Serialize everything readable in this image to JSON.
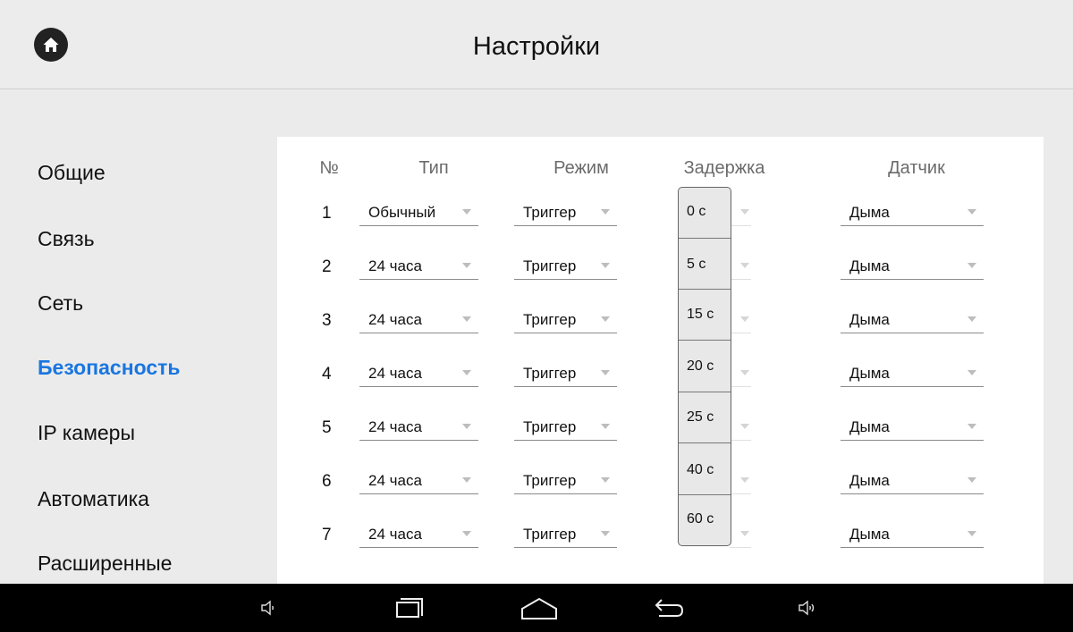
{
  "header": {
    "title": "Настройки"
  },
  "sidebar": {
    "items": [
      {
        "label": "Общие"
      },
      {
        "label": "Связь"
      },
      {
        "label": "Сеть"
      },
      {
        "label": "Безопасность",
        "active": true
      },
      {
        "label": "IP камеры"
      },
      {
        "label": "Автоматика"
      },
      {
        "label": "Расширенные"
      }
    ]
  },
  "table": {
    "headers": {
      "num": "№",
      "type": "Тип",
      "mode": "Режим",
      "delay": "Задержка",
      "sensor": "Датчик"
    },
    "rows": [
      {
        "num": "1",
        "type": "Обычный",
        "mode": "Триггер",
        "sensor": "Дыма"
      },
      {
        "num": "2",
        "type": "24 часа",
        "mode": "Триггер",
        "sensor": "Дыма"
      },
      {
        "num": "3",
        "type": "24 часа",
        "mode": "Триггер",
        "sensor": "Дыма"
      },
      {
        "num": "4",
        "type": "24 часа",
        "mode": "Триггер",
        "sensor": "Дыма"
      },
      {
        "num": "5",
        "type": "24 часа",
        "mode": "Триггер",
        "sensor": "Дыма"
      },
      {
        "num": "6",
        "type": "24 часа",
        "mode": "Триггер",
        "sensor": "Дыма"
      },
      {
        "num": "7",
        "type": "24 часа",
        "mode": "Триггер",
        "sensor": "Дыма"
      }
    ]
  },
  "delay_options": [
    "0 с",
    "5 с",
    "15 с",
    "20 с",
    "25 с",
    "40 с",
    "60 с"
  ],
  "colors": {
    "accent": "#1976e0",
    "navbar": "#000000",
    "background": "#ebebeb"
  },
  "icons": {
    "home": "home-icon",
    "volume_down": "volume-down-icon",
    "recent_apps": "recent-apps-icon",
    "home_nav": "home-nav-icon",
    "back": "back-icon",
    "volume_up": "volume-up-icon"
  }
}
